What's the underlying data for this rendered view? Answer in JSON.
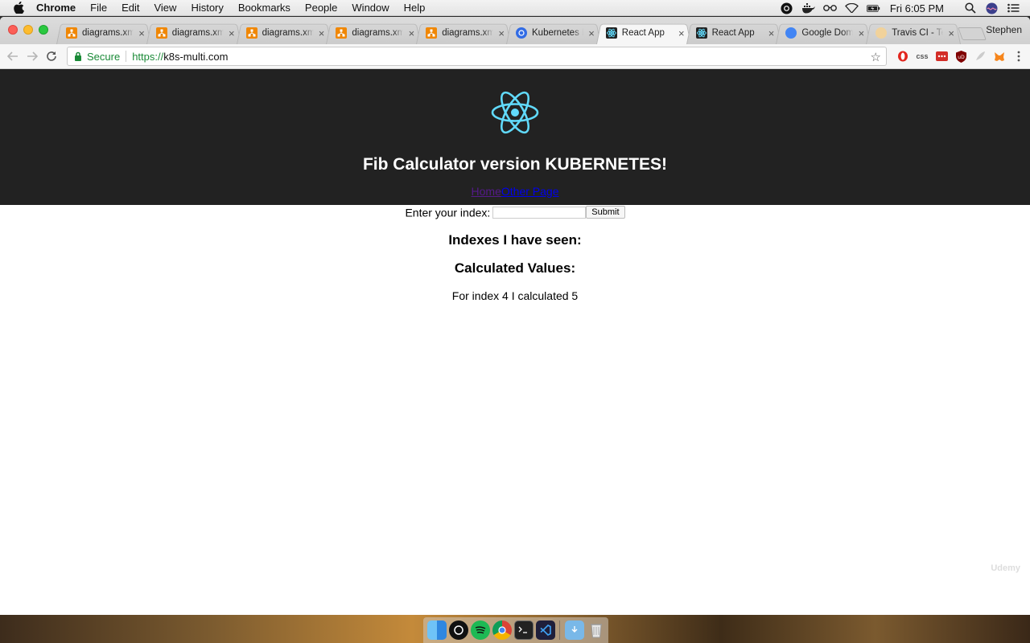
{
  "menubar": {
    "app_name": "Chrome",
    "items": [
      "File",
      "Edit",
      "View",
      "History",
      "Bookmarks",
      "People",
      "Window",
      "Help"
    ],
    "clock": "Fri 6:05 PM",
    "status_icons": [
      "obs-icon",
      "docker-icon",
      "glasses-icon",
      "wifi-icon",
      "battery-icon",
      "search-icon",
      "siri-icon",
      "list-icon"
    ]
  },
  "browser": {
    "tabs": [
      {
        "title": "diagrams.xml",
        "icon": "drawio-icon",
        "color": "#f08705",
        "active": false
      },
      {
        "title": "diagrams.xml",
        "icon": "drawio-icon",
        "color": "#f08705",
        "active": false
      },
      {
        "title": "diagrams.xml",
        "icon": "drawio-icon",
        "color": "#f08705",
        "active": false
      },
      {
        "title": "diagrams.xml",
        "icon": "drawio-icon",
        "color": "#f08705",
        "active": false
      },
      {
        "title": "diagrams.xml",
        "icon": "drawio-icon",
        "color": "#f08705",
        "active": false
      },
      {
        "title": "Kubernetes E",
        "icon": "kubernetes-icon",
        "color": "#326ce5",
        "active": false
      },
      {
        "title": "React App",
        "icon": "react-icon",
        "color": "#222222",
        "active": true
      },
      {
        "title": "React App",
        "icon": "react-icon",
        "color": "#222222",
        "active": false
      },
      {
        "title": "Google Doma",
        "icon": "google-domains-icon",
        "color": "#4285f4",
        "active": false
      },
      {
        "title": "Travis CI - Te",
        "icon": "travis-icon",
        "color": "#cd3b3b",
        "active": false
      }
    ],
    "profile_name": "Stephen",
    "omnibox": {
      "secure_label": "Secure",
      "scheme": "https://",
      "host": "k8s-multi.com"
    },
    "extensions": [
      "opera-icon",
      "css-icon",
      "lastpass-icon",
      "ublock-icon",
      "feather-icon",
      "metamask-icon",
      "menu-icon"
    ]
  },
  "page": {
    "header_title": "Fib Calculator version KUBERNETES!",
    "nav_home": "Home",
    "nav_other": "Other Page",
    "form_label": "Enter your index:",
    "input_value": "",
    "submit_label": "Submit",
    "seen_heading": "Indexes I have seen:",
    "calculated_heading": "Calculated Values:",
    "calculated_line": "For index 4 I calculated 5"
  },
  "watermark": "Udemy",
  "colors": {
    "header_bg": "#222222",
    "react_blue": "#61dafb",
    "link": "#0000ee",
    "visited_link": "#551a8b",
    "secure_green": "#1a8a37"
  },
  "dock": [
    "finder-icon",
    "obs-icon",
    "spotify-icon",
    "chrome-icon",
    "terminal-icon",
    "vscode-icon",
    "downloads-folder-icon",
    "trash-icon"
  ]
}
